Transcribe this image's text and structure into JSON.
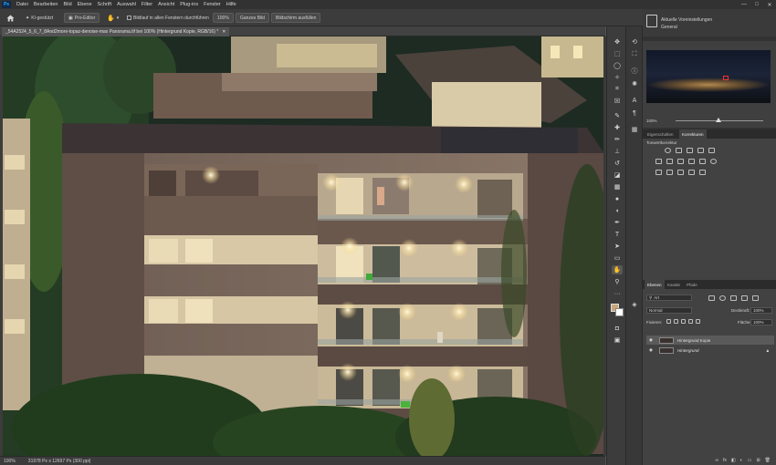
{
  "app": {
    "logo": "Ps"
  },
  "menu": [
    "Datei",
    "Bearbeiten",
    "Bild",
    "Ebene",
    "Schrift",
    "Auswahl",
    "Filter",
    "Ansicht",
    "Plug-ins",
    "Fenster",
    "Hilfe"
  ],
  "window_controls": [
    "—",
    "□",
    "✕"
  ],
  "options": {
    "home_icon": "home-icon",
    "ai_label": "KI-gestützt",
    "pro_editor_label": "Pro-Editor",
    "hand_icon": "hand-icon",
    "scroll_all_label": "Bildlauf in allen Fenstern durchführen",
    "zoom_100_label": "100%",
    "fit_screen_label": "Ganzes Bild",
    "fill_screen_label": "Bildschirm ausfüllen"
  },
  "document": {
    "tab_title": "_54A2524_5_6_7_8And2more-topaz-denoise-max Panorama.tif bei 100% (Hintergrund Kopie, RGB/16) *",
    "close": "✕"
  },
  "status": {
    "zoom": "100%",
    "dimensions": "31978 Px x 12697 Px (300 ppi)"
  },
  "tools": [
    "move-icon",
    "marquee-icon",
    "lasso-icon",
    "magic-wand-icon",
    "crop-icon",
    "frame-icon",
    "eyedropper-icon",
    "healing-icon",
    "brush-icon",
    "stamp-icon",
    "history-brush-icon",
    "eraser-icon",
    "gradient-icon",
    "blur-icon",
    "dodge-icon",
    "pen-icon",
    "type-icon",
    "path-select-icon",
    "shape-icon",
    "hand-icon",
    "zoom-icon",
    "more-icon"
  ],
  "panel_icons": [
    "history-icon",
    "navigator-icon",
    "info-icon",
    "brush-presets-icon",
    "character-icon",
    "paragraph-icon",
    "swatches-icon",
    "layers-icon"
  ],
  "presets": {
    "title": "Aktuelle Voreinstellungen",
    "subtitle": "General"
  },
  "navigator": {
    "zoom_value": "100%"
  },
  "adjust_tabs": [
    "Eigenschaften",
    "Korrekturen"
  ],
  "corrections": {
    "label": "Tonwertkorrektur"
  },
  "layers_tabs": [
    "Ebenen",
    "Kanäle",
    "Pfade"
  ],
  "layers": {
    "filter_label": "Art",
    "blend_mode": "Normal",
    "opacity_label": "Deckkraft:",
    "opacity_value": "100%",
    "lock_label": "Fixieren:",
    "fill_label": "Fläche:",
    "fill_value": "100%",
    "items": [
      {
        "name": "Hintergrund Kopie",
        "selected": true
      },
      {
        "name": "Hintergrund",
        "selected": false
      }
    ]
  },
  "colors": {
    "accent": "#31a8ff",
    "menubar": "#323232",
    "panel": "#424242"
  }
}
